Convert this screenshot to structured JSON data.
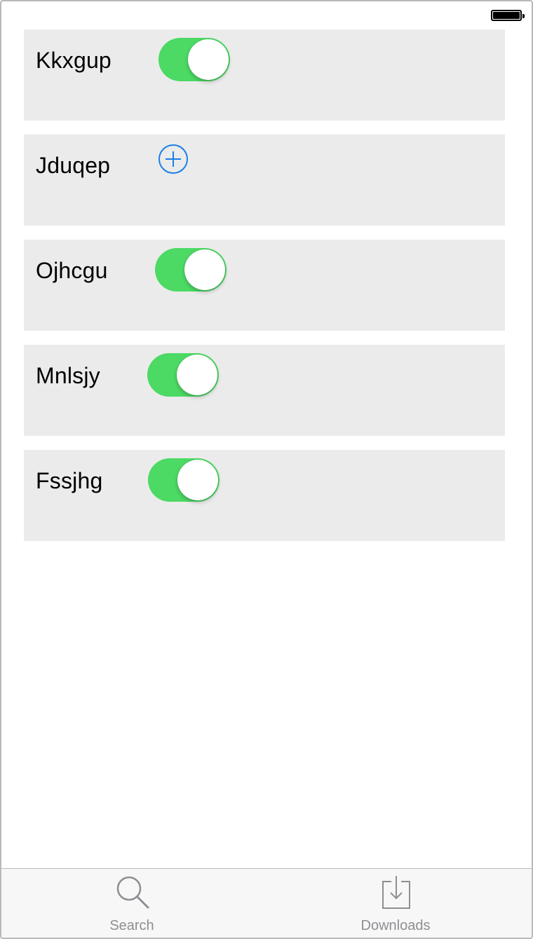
{
  "status_bar": {
    "battery_icon": "battery-full-icon"
  },
  "rows": [
    {
      "label": "Kkxgup",
      "control": "toggle",
      "on": true
    },
    {
      "label": "Jduqep",
      "control": "add-button",
      "icon": "plus-circle-icon"
    },
    {
      "label": "Ojhcgu",
      "control": "toggle",
      "on": true
    },
    {
      "label": "Mnlsjy",
      "control": "toggle",
      "on": true
    },
    {
      "label": "Fssjhg",
      "control": "toggle",
      "on": true
    }
  ],
  "tab_bar": {
    "tabs": [
      {
        "label": "Search",
        "icon": "magnifier-icon"
      },
      {
        "label": "Downloads",
        "icon": "download-tray-icon"
      }
    ]
  },
  "colors": {
    "toggle_on": "#4cd964",
    "row_background": "#ebebeb",
    "accent": "#1a7fe8",
    "tab_inactive": "#8e8e93"
  }
}
